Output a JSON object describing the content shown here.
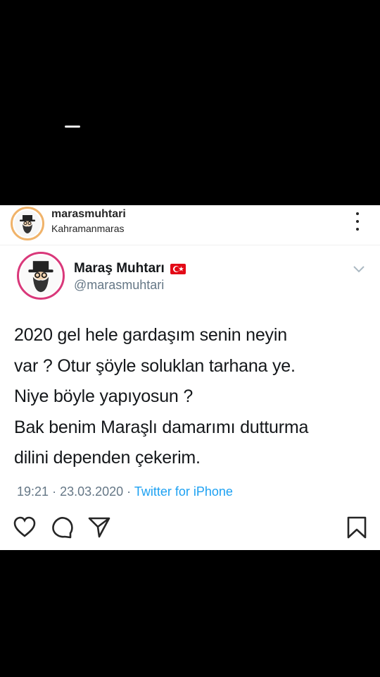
{
  "instagram": {
    "username": "marasmuhtari",
    "location": "Kahramanmaras"
  },
  "tweet": {
    "display_name": "Maraş Muhtarı",
    "handle": "@marasmuhtari",
    "text": "2020 gel hele gardaşım senin neyin\nvar ? Otur şöyle soluklan tarhana ye.\nNiye böyle yapıyosun ?\nBak benim Maraşlı damarımı dutturma\ndilini dependen çekerim.",
    "time": "19:21",
    "date": "23.03.2020",
    "source": "Twitter for iPhone",
    "flag": "turkey-flag-emoji"
  },
  "actions": [
    "heart-icon",
    "comment-icon",
    "share-icon",
    "bookmark-icon"
  ],
  "colors": {
    "accent": "#1da1f2",
    "secondary_text": "#657786",
    "primary_text": "#14171a"
  }
}
